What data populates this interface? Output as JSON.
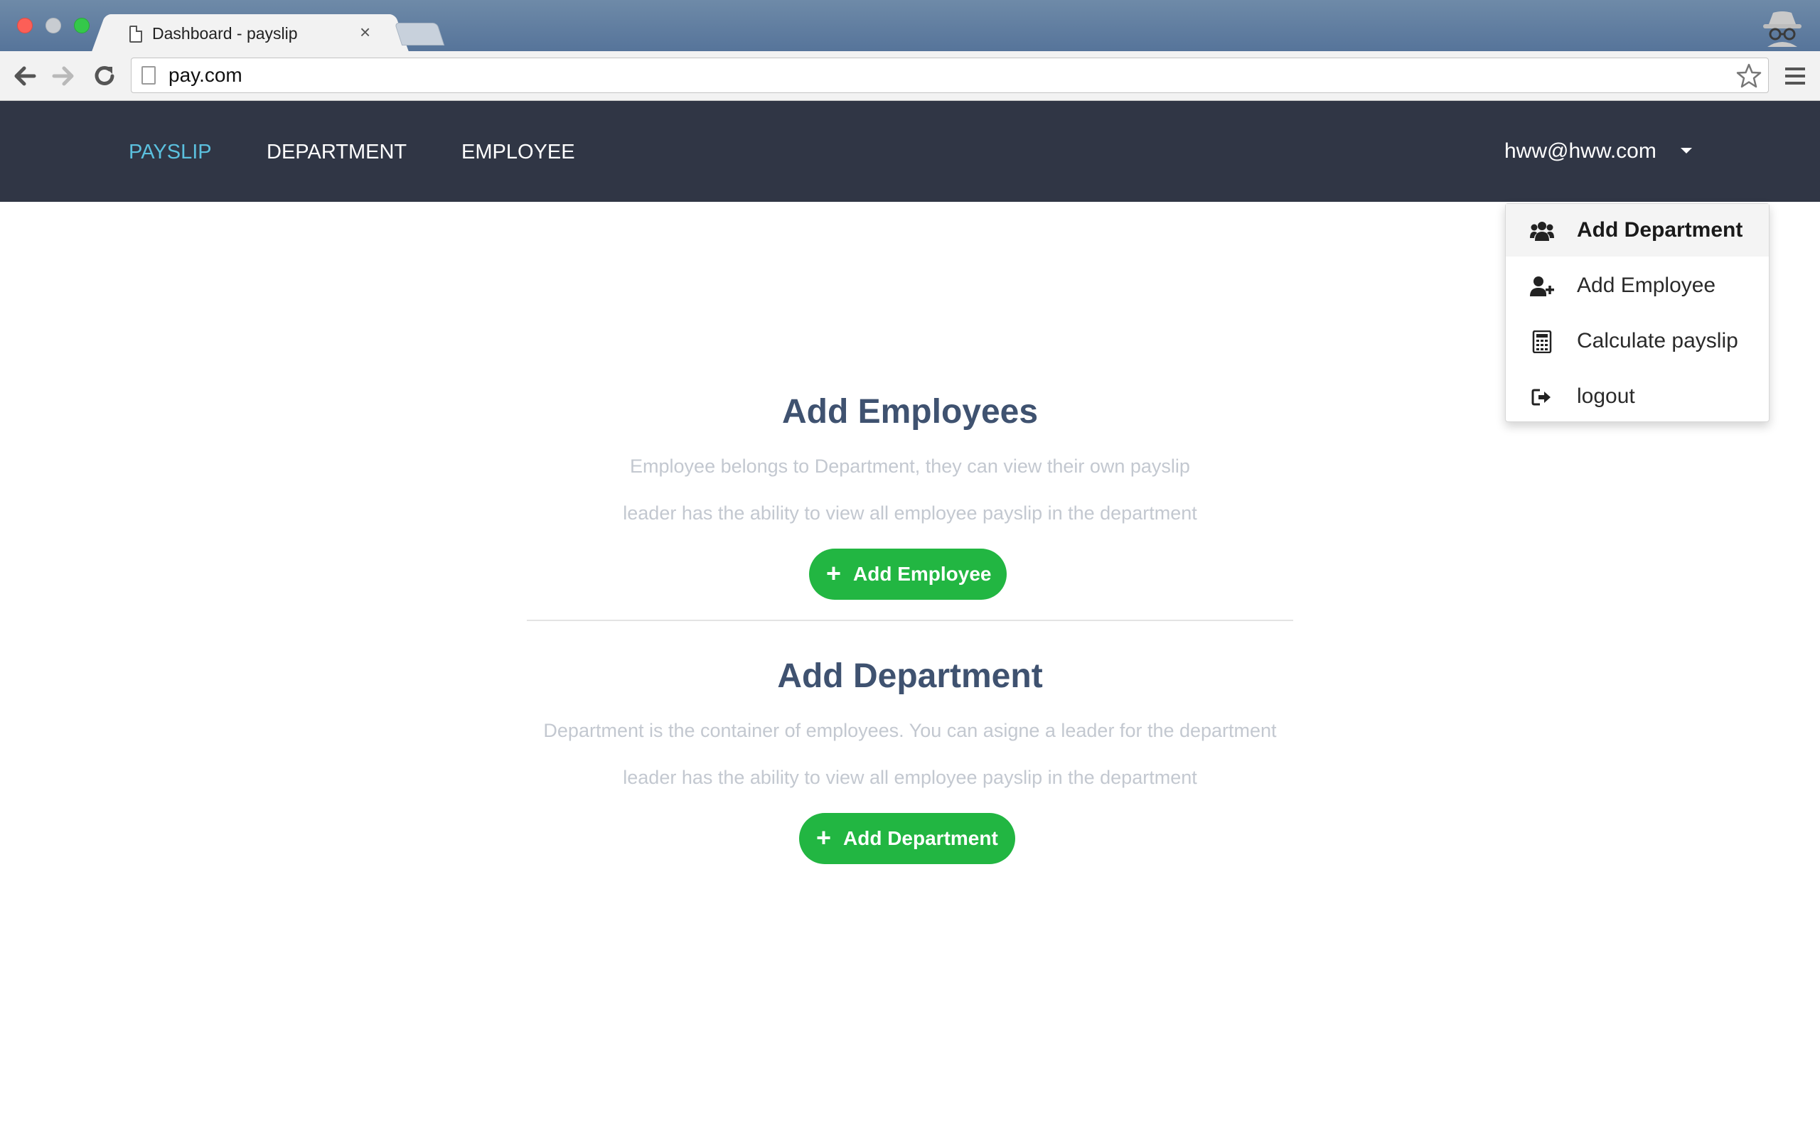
{
  "browser": {
    "tab_title": "Dashboard - payslip",
    "tab_close": "×",
    "url": "pay.com"
  },
  "nav": {
    "links": [
      "PAYSLIP",
      "DEPARTMENT",
      "EMPLOYEE"
    ],
    "user": "hww@hww.com"
  },
  "dropdown": {
    "items": [
      {
        "label": "Add Department",
        "icon": "users-icon"
      },
      {
        "label": "Add Employee",
        "icon": "user-plus-icon"
      },
      {
        "label": "Calculate payslip",
        "icon": "calculator-icon"
      },
      {
        "label": "logout",
        "icon": "sign-out-icon"
      }
    ]
  },
  "employees": {
    "title": "Add Employees",
    "desc1": "Employee belongs to Department, they can view their own payslip",
    "desc2": "leader has the ability to view all employee payslip in the department",
    "button": "Add Employee",
    "plus": "+"
  },
  "departments": {
    "title": "Add Department",
    "desc1": "Department is the container of employees. You can asigne a leader for the department",
    "desc2": "leader has the ability to view all employee payslip in the department",
    "button": "Add Department",
    "plus": "+"
  },
  "colors": {
    "nav_bg": "#303645",
    "nav_active": "#5bc0de",
    "button_green": "#22b642",
    "heading": "#3f5270",
    "muted_text": "#c3c8d0"
  }
}
